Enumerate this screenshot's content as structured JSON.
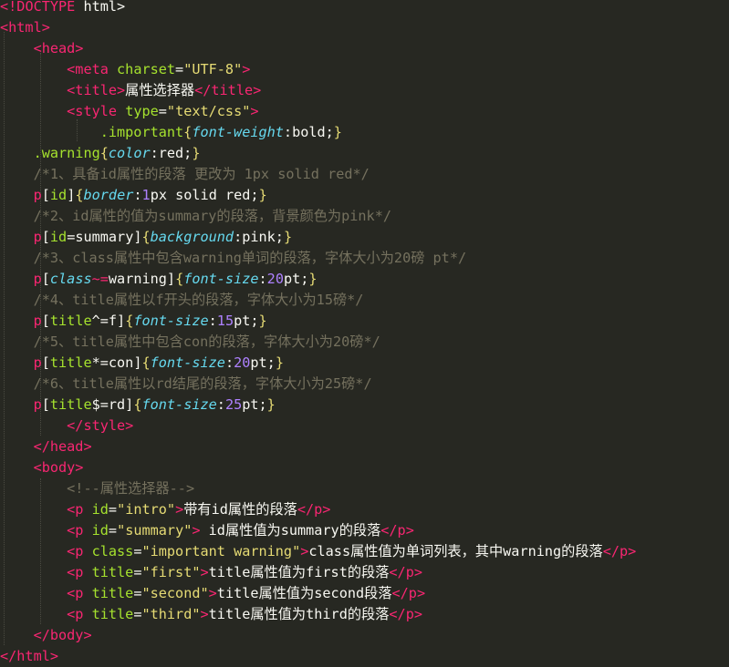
{
  "editor": {
    "lines": [
      [
        {
          "c": "tag",
          "t": "<!"
        },
        {
          "c": "tag",
          "t": "DOCTYPE"
        },
        {
          "c": "txt",
          "t": " html>"
        }
      ],
      [
        {
          "c": "tag",
          "t": "<html>"
        }
      ],
      [
        {
          "c": "txt",
          "t": "    "
        },
        {
          "c": "tag",
          "t": "<head>"
        }
      ],
      [
        {
          "c": "txt",
          "t": "        "
        },
        {
          "c": "tag",
          "t": "<meta"
        },
        {
          "c": "txt",
          "t": " "
        },
        {
          "c": "attr",
          "t": "charset"
        },
        {
          "c": "txt",
          "t": "="
        },
        {
          "c": "str",
          "t": "\"UTF-8\""
        },
        {
          "c": "tag",
          "t": ">"
        }
      ],
      [
        {
          "c": "txt",
          "t": "        "
        },
        {
          "c": "tag",
          "t": "<title>"
        },
        {
          "c": "txt",
          "t": "属性选择器"
        },
        {
          "c": "tag",
          "t": "</title>"
        }
      ],
      [
        {
          "c": "txt",
          "t": "        "
        },
        {
          "c": "tag",
          "t": "<style"
        },
        {
          "c": "txt",
          "t": " "
        },
        {
          "c": "attr",
          "t": "type"
        },
        {
          "c": "txt",
          "t": "="
        },
        {
          "c": "str",
          "t": "\"text/css\""
        },
        {
          "c": "tag",
          "t": ">"
        }
      ],
      [
        {
          "c": "txt",
          "t": "            "
        },
        {
          "c": "sel",
          "t": ".important"
        },
        {
          "c": "paren",
          "t": "{"
        },
        {
          "c": "prop",
          "t": "font-weight"
        },
        {
          "c": "txt",
          "t": ":bold;"
        },
        {
          "c": "paren",
          "t": "}"
        }
      ],
      [
        {
          "c": "txt",
          "t": "    "
        },
        {
          "c": "sel",
          "t": ".warning"
        },
        {
          "c": "paren",
          "t": "{"
        },
        {
          "c": "prop",
          "t": "color"
        },
        {
          "c": "txt",
          "t": ":red;"
        },
        {
          "c": "paren",
          "t": "}"
        }
      ],
      [
        {
          "c": "txt",
          "t": "    "
        },
        {
          "c": "cmt",
          "t": "/*1、具备id属性的段落 更改为 1px solid red*/"
        }
      ],
      [
        {
          "c": "txt",
          "t": "    "
        },
        {
          "c": "tag",
          "t": "p"
        },
        {
          "c": "txt",
          "t": "["
        },
        {
          "c": "attr",
          "t": "id"
        },
        {
          "c": "txt",
          "t": "]"
        },
        {
          "c": "paren",
          "t": "{"
        },
        {
          "c": "prop",
          "t": "border"
        },
        {
          "c": "txt",
          "t": ":"
        },
        {
          "c": "num",
          "t": "1"
        },
        {
          "c": "txt",
          "t": "px solid red;"
        },
        {
          "c": "paren",
          "t": "}"
        }
      ],
      [
        {
          "c": "txt",
          "t": "    "
        },
        {
          "c": "cmt",
          "t": "/*2、id属性的值为summary的段落，背景颜色为pink*/"
        }
      ],
      [
        {
          "c": "txt",
          "t": "    "
        },
        {
          "c": "tag",
          "t": "p"
        },
        {
          "c": "txt",
          "t": "["
        },
        {
          "c": "attr",
          "t": "id"
        },
        {
          "c": "txt",
          "t": "=summary]"
        },
        {
          "c": "paren",
          "t": "{"
        },
        {
          "c": "prop",
          "t": "background"
        },
        {
          "c": "txt",
          "t": ":pink;"
        },
        {
          "c": "paren",
          "t": "}"
        }
      ],
      [
        {
          "c": "txt",
          "t": "    "
        },
        {
          "c": "cmt",
          "t": "/*3、class属性中包含warning单词的段落，字体大小为20磅 pt*/"
        }
      ],
      [
        {
          "c": "txt",
          "t": "    "
        },
        {
          "c": "tag",
          "t": "p"
        },
        {
          "c": "txt",
          "t": "["
        },
        {
          "c": "prop",
          "t": "class"
        },
        {
          "c": "op",
          "t": "~="
        },
        {
          "c": "txt",
          "t": "warning]"
        },
        {
          "c": "paren",
          "t": "{"
        },
        {
          "c": "prop",
          "t": "font-size"
        },
        {
          "c": "txt",
          "t": ":"
        },
        {
          "c": "num",
          "t": "20"
        },
        {
          "c": "txt",
          "t": "pt;"
        },
        {
          "c": "paren",
          "t": "}"
        }
      ],
      [
        {
          "c": "txt",
          "t": "    "
        },
        {
          "c": "cmt",
          "t": "/*4、title属性以f开头的段落，字体大小为15磅*/"
        }
      ],
      [
        {
          "c": "txt",
          "t": "    "
        },
        {
          "c": "tag",
          "t": "p"
        },
        {
          "c": "txt",
          "t": "["
        },
        {
          "c": "attr",
          "t": "title"
        },
        {
          "c": "txt",
          "t": "^=f]"
        },
        {
          "c": "paren",
          "t": "{"
        },
        {
          "c": "prop",
          "t": "font-size"
        },
        {
          "c": "txt",
          "t": ":"
        },
        {
          "c": "num",
          "t": "15"
        },
        {
          "c": "txt",
          "t": "pt;"
        },
        {
          "c": "paren",
          "t": "}"
        }
      ],
      [
        {
          "c": "txt",
          "t": "    "
        },
        {
          "c": "cmt",
          "t": "/*5、title属性中包含con的段落，字体大小为20磅*/"
        }
      ],
      [
        {
          "c": "txt",
          "t": "    "
        },
        {
          "c": "tag",
          "t": "p"
        },
        {
          "c": "txt",
          "t": "["
        },
        {
          "c": "attr",
          "t": "title"
        },
        {
          "c": "txt",
          "t": "*=con]"
        },
        {
          "c": "paren",
          "t": "{"
        },
        {
          "c": "prop",
          "t": "font-size"
        },
        {
          "c": "txt",
          "t": ":"
        },
        {
          "c": "num",
          "t": "20"
        },
        {
          "c": "txt",
          "t": "pt;"
        },
        {
          "c": "paren",
          "t": "}"
        }
      ],
      [
        {
          "c": "txt",
          "t": "    "
        },
        {
          "c": "cmt",
          "t": "/*6、title属性以rd结尾的段落，字体大小为25磅*/"
        }
      ],
      [
        {
          "c": "txt",
          "t": "    "
        },
        {
          "c": "tag",
          "t": "p"
        },
        {
          "c": "txt",
          "t": "["
        },
        {
          "c": "attr",
          "t": "title"
        },
        {
          "c": "txt",
          "t": "$=rd]"
        },
        {
          "c": "paren",
          "t": "{"
        },
        {
          "c": "prop",
          "t": "font-size"
        },
        {
          "c": "txt",
          "t": ":"
        },
        {
          "c": "num",
          "t": "25"
        },
        {
          "c": "txt",
          "t": "pt;"
        },
        {
          "c": "paren",
          "t": "}"
        }
      ],
      [
        {
          "c": "txt",
          "t": "        "
        },
        {
          "c": "tag",
          "t": "</style>"
        }
      ],
      [
        {
          "c": "txt",
          "t": "    "
        },
        {
          "c": "tag",
          "t": "</head>"
        }
      ],
      [
        {
          "c": "txt",
          "t": "    "
        },
        {
          "c": "tag",
          "t": "<body>"
        }
      ],
      [
        {
          "c": "txt",
          "t": "        "
        },
        {
          "c": "cmt",
          "t": "<!--属性选择器-->"
        }
      ],
      [
        {
          "c": "txt",
          "t": "        "
        },
        {
          "c": "tag",
          "t": "<p"
        },
        {
          "c": "txt",
          "t": " "
        },
        {
          "c": "attr",
          "t": "id"
        },
        {
          "c": "txt",
          "t": "="
        },
        {
          "c": "str",
          "t": "\"intro\""
        },
        {
          "c": "tag",
          "t": ">"
        },
        {
          "c": "txt",
          "t": "带有id属性的段落"
        },
        {
          "c": "tag",
          "t": "</p>"
        }
      ],
      [
        {
          "c": "txt",
          "t": "        "
        },
        {
          "c": "tag",
          "t": "<p"
        },
        {
          "c": "txt",
          "t": " "
        },
        {
          "c": "attr",
          "t": "id"
        },
        {
          "c": "txt",
          "t": "="
        },
        {
          "c": "str",
          "t": "\"summary\""
        },
        {
          "c": "tag",
          "t": ">"
        },
        {
          "c": "txt",
          "t": " id属性值为summary的段落"
        },
        {
          "c": "tag",
          "t": "</p>"
        }
      ],
      [
        {
          "c": "txt",
          "t": "        "
        },
        {
          "c": "tag",
          "t": "<p"
        },
        {
          "c": "txt",
          "t": " "
        },
        {
          "c": "attr",
          "t": "class"
        },
        {
          "c": "txt",
          "t": "="
        },
        {
          "c": "str",
          "t": "\"important warning\""
        },
        {
          "c": "tag",
          "t": ">"
        },
        {
          "c": "txt",
          "t": "class属性值为单词列表，其中warning的段落"
        },
        {
          "c": "tag",
          "t": "</p>"
        }
      ],
      [
        {
          "c": "txt",
          "t": "        "
        },
        {
          "c": "tag",
          "t": "<p"
        },
        {
          "c": "txt",
          "t": " "
        },
        {
          "c": "attr",
          "t": "title"
        },
        {
          "c": "txt",
          "t": "="
        },
        {
          "c": "str",
          "t": "\"first\""
        },
        {
          "c": "tag",
          "t": ">"
        },
        {
          "c": "txt",
          "t": "title属性值为first的段落"
        },
        {
          "c": "tag",
          "t": "</p>"
        }
      ],
      [
        {
          "c": "txt",
          "t": "        "
        },
        {
          "c": "tag",
          "t": "<p"
        },
        {
          "c": "txt",
          "t": " "
        },
        {
          "c": "attr",
          "t": "title"
        },
        {
          "c": "txt",
          "t": "="
        },
        {
          "c": "str",
          "t": "\"second\""
        },
        {
          "c": "tag",
          "t": ">"
        },
        {
          "c": "txt",
          "t": "title属性值为second段落"
        },
        {
          "c": "tag",
          "t": "</p>"
        }
      ],
      [
        {
          "c": "txt",
          "t": "        "
        },
        {
          "c": "tag",
          "t": "<p"
        },
        {
          "c": "txt",
          "t": " "
        },
        {
          "c": "attr",
          "t": "title"
        },
        {
          "c": "txt",
          "t": "="
        },
        {
          "c": "str",
          "t": "\"third\""
        },
        {
          "c": "tag",
          "t": ">"
        },
        {
          "c": "txt",
          "t": "title属性值为third的段落"
        },
        {
          "c": "tag",
          "t": "</p>"
        }
      ],
      [
        {
          "c": "txt",
          "t": "    "
        },
        {
          "c": "tag",
          "t": "</body>"
        }
      ],
      [
        {
          "c": "tag",
          "t": "</html>"
        }
      ]
    ]
  }
}
